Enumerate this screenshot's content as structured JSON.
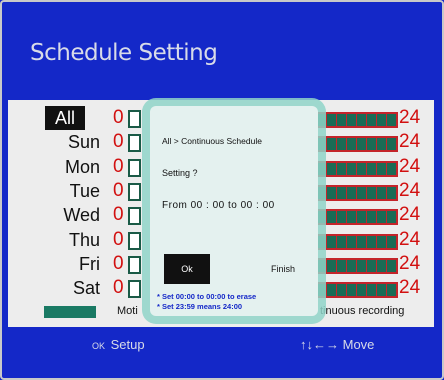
{
  "title": "Schedule Setting",
  "days": [
    {
      "label": "All",
      "selected": true
    },
    {
      "label": "Sun",
      "selected": false
    },
    {
      "label": "Mon",
      "selected": false
    },
    {
      "label": "Tue",
      "selected": false
    },
    {
      "label": "Wed",
      "selected": false
    },
    {
      "label": "Thu",
      "selected": false
    },
    {
      "label": "Fri",
      "selected": false
    },
    {
      "label": "Sat",
      "selected": false
    }
  ],
  "scale": {
    "start": "0",
    "end": "24"
  },
  "legend": {
    "motion_label": "Moti",
    "continuous_label": "tinuous recording"
  },
  "footer": {
    "ok_glyph": "OK",
    "setup_label": "Setup",
    "move_arrows": "↑↓←→",
    "move_label": "Move"
  },
  "dialog": {
    "breadcrumb": "All > Continuous Schedule",
    "question": "Setting ?",
    "range_prefix": "From",
    "from_time": "00 : 00",
    "range_mid": "to",
    "to_time": "00 : 00",
    "ok_label": "Ok",
    "finish_label": "Finish",
    "note_erase": "* Set 00:00 to 00:00 to erase",
    "note_24": "* Set 23:59 means 24:00"
  },
  "colors": {
    "background": "#1428c8",
    "panel": "#ededed",
    "accent_red": "#d21010",
    "schedule_green": "#1a6b55",
    "dialog_glow": "#8fd4c8"
  }
}
